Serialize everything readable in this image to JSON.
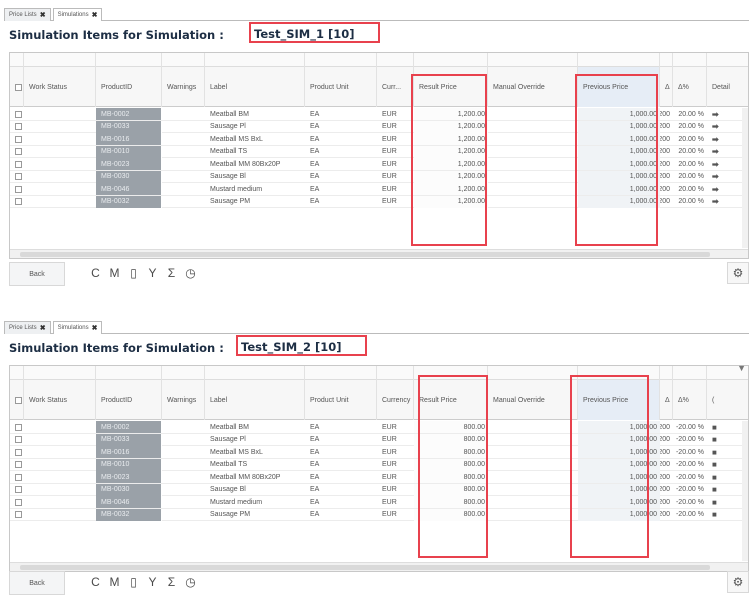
{
  "tabs": {
    "price_lists": "Price Lists",
    "simulations": "Simulations",
    "close_glyph": "✖"
  },
  "panel1": {
    "title_prefix": "Simulation Items for Simulation : ",
    "sim_name": "Test_SIM_1 [10]",
    "columns": [
      "Work Status",
      "ProductID",
      "Warnings",
      "Label",
      "Product Unit",
      "Curr...",
      "Result Price",
      "Manual Override",
      "Previous Price",
      "Δ",
      "Δ%",
      "Detail"
    ],
    "rows": [
      {
        "product_id": "MB-0002",
        "label": "Meatball BM",
        "unit": "EA",
        "currency": "EUR",
        "result_price": "1,200.00",
        "manual_override": "",
        "previous_price": "1,000.00",
        "delta": "200",
        "delta_pct": "20.00 %"
      },
      {
        "product_id": "MB-0033",
        "label": "Sausage Pl",
        "unit": "EA",
        "currency": "EUR",
        "result_price": "1,200.00",
        "manual_override": "",
        "previous_price": "1,000.00",
        "delta": "200",
        "delta_pct": "20.00 %"
      },
      {
        "product_id": "MB-0016",
        "label": "Meatball MS BxL",
        "unit": "EA",
        "currency": "EUR",
        "result_price": "1,200.00",
        "manual_override": "",
        "previous_price": "1,000.00",
        "delta": "200",
        "delta_pct": "20.00 %"
      },
      {
        "product_id": "MB-0010",
        "label": "Meatball TS",
        "unit": "EA",
        "currency": "EUR",
        "result_price": "1,200.00",
        "manual_override": "",
        "previous_price": "1,000.00",
        "delta": "200",
        "delta_pct": "20.00 %"
      },
      {
        "product_id": "MB-0023",
        "label": "Meatball MM 80Bx20P",
        "unit": "EA",
        "currency": "EUR",
        "result_price": "1,200.00",
        "manual_override": "",
        "previous_price": "1,000.00",
        "delta": "200",
        "delta_pct": "20.00 %"
      },
      {
        "product_id": "MB-0030",
        "label": "Sausage Bl",
        "unit": "EA",
        "currency": "EUR",
        "result_price": "1,200.00",
        "manual_override": "",
        "previous_price": "1,000.00",
        "delta": "200",
        "delta_pct": "20.00 %"
      },
      {
        "product_id": "MB-0046",
        "label": "Mustard medium",
        "unit": "EA",
        "currency": "EUR",
        "result_price": "1,200.00",
        "manual_override": "",
        "previous_price": "1,000.00",
        "delta": "200",
        "delta_pct": "20.00 %"
      },
      {
        "product_id": "MB-0032",
        "label": "Sausage PM",
        "unit": "EA",
        "currency": "EUR",
        "result_price": "1,200.00",
        "manual_override": "",
        "previous_price": "1,000.00",
        "delta": "200",
        "delta_pct": "20.00 %"
      }
    ],
    "detail_glyph": "➡"
  },
  "panel2": {
    "title_prefix": "Simulation Items for Simulation : ",
    "sim_name": "Test_SIM_2 [10]",
    "columns": [
      "Work Status",
      "ProductID",
      "Warnings",
      "Label",
      "Product Unit",
      "Currency",
      "Result Price",
      "Manual Override",
      "Previous Price",
      "Δ",
      "Δ%",
      "("
    ],
    "rows": [
      {
        "product_id": "MB-0002",
        "label": "Meatball BM",
        "unit": "EA",
        "currency": "EUR",
        "result_price": "800.00",
        "manual_override": "",
        "previous_price": "1,000.00",
        "delta": "-200",
        "delta_pct": "-20.00 %"
      },
      {
        "product_id": "MB-0033",
        "label": "Sausage Pl",
        "unit": "EA",
        "currency": "EUR",
        "result_price": "800.00",
        "manual_override": "",
        "previous_price": "1,000.00",
        "delta": "-200",
        "delta_pct": "-20.00 %"
      },
      {
        "product_id": "MB-0016",
        "label": "Meatball MS BxL",
        "unit": "EA",
        "currency": "EUR",
        "result_price": "800.00",
        "manual_override": "",
        "previous_price": "1,000.00",
        "delta": "-200",
        "delta_pct": "-20.00 %"
      },
      {
        "product_id": "MB-0010",
        "label": "Meatball TS",
        "unit": "EA",
        "currency": "EUR",
        "result_price": "800.00",
        "manual_override": "",
        "previous_price": "1,000.00",
        "delta": "-200",
        "delta_pct": "-20.00 %"
      },
      {
        "product_id": "MB-0023",
        "label": "Meatball MM 80Bx20P",
        "unit": "EA",
        "currency": "EUR",
        "result_price": "800.00",
        "manual_override": "",
        "previous_price": "1,000.00",
        "delta": "-200",
        "delta_pct": "-20.00 %"
      },
      {
        "product_id": "MB-0030",
        "label": "Sausage Bl",
        "unit": "EA",
        "currency": "EUR",
        "result_price": "800.00",
        "manual_override": "",
        "previous_price": "1,000.00",
        "delta": "-200",
        "delta_pct": "-20.00 %"
      },
      {
        "product_id": "MB-0046",
        "label": "Mustard medium",
        "unit": "EA",
        "currency": "EUR",
        "result_price": "800.00",
        "manual_override": "",
        "previous_price": "1,000.00",
        "delta": "-200",
        "delta_pct": "-20.00 %"
      },
      {
        "product_id": "MB-0032",
        "label": "Sausage PM",
        "unit": "EA",
        "currency": "EUR",
        "result_price": "800.00",
        "manual_override": "",
        "previous_price": "1,000.00",
        "delta": "-200",
        "delta_pct": "-20.00 %"
      }
    ],
    "detail_glyph": "■"
  },
  "toolbar": {
    "back_label": "Back",
    "icons": [
      {
        "name": "refresh-icon",
        "glyph": "C"
      },
      {
        "name": "mass-edit-icon",
        "glyph": "M"
      },
      {
        "name": "export-icon",
        "glyph": "▯"
      },
      {
        "name": "filter-icon",
        "glyph": "Y"
      },
      {
        "name": "sum-icon",
        "glyph": "Σ"
      },
      {
        "name": "history-icon",
        "glyph": "◷"
      }
    ],
    "gear_glyph": "⚙",
    "funnel_glyph": "▼"
  },
  "colors": {
    "highlight": "#e8414d",
    "title": "#1d2e44",
    "productid_bg": "#9aa1a8"
  }
}
